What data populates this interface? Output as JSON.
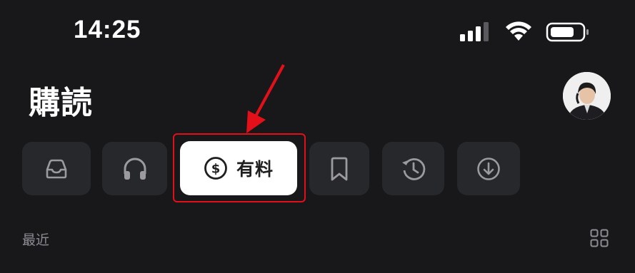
{
  "status_bar": {
    "time": "14:25",
    "signal_icon": "cellular-signal-icon",
    "wifi_icon": "wifi-icon",
    "battery_icon": "battery-icon"
  },
  "header": {
    "title": "購読",
    "avatar_icon": "profile-avatar"
  },
  "tabs": [
    {
      "icon": "inbox-tray-icon",
      "active": false
    },
    {
      "icon": "headphones-icon",
      "active": false
    },
    {
      "icon": "dollar-circle-icon",
      "label": "有料",
      "active": true
    },
    {
      "icon": "bookmark-icon",
      "active": false
    },
    {
      "icon": "history-clock-icon",
      "active": false
    },
    {
      "icon": "download-circle-icon",
      "active": false
    }
  ],
  "annotation": {
    "color": "#e3101a",
    "arrow_icon": "red-arrow-pointer",
    "highlight": "red-highlight-box"
  },
  "section": {
    "label": "最近",
    "layout_toggle_icon": "grid-view-icon"
  },
  "colors": {
    "background": "#18181a",
    "tab_background": "#26282b",
    "tab_icon": "#9a9a9f",
    "active_tab_background": "#ffffff",
    "muted_text": "#8d8d93"
  }
}
